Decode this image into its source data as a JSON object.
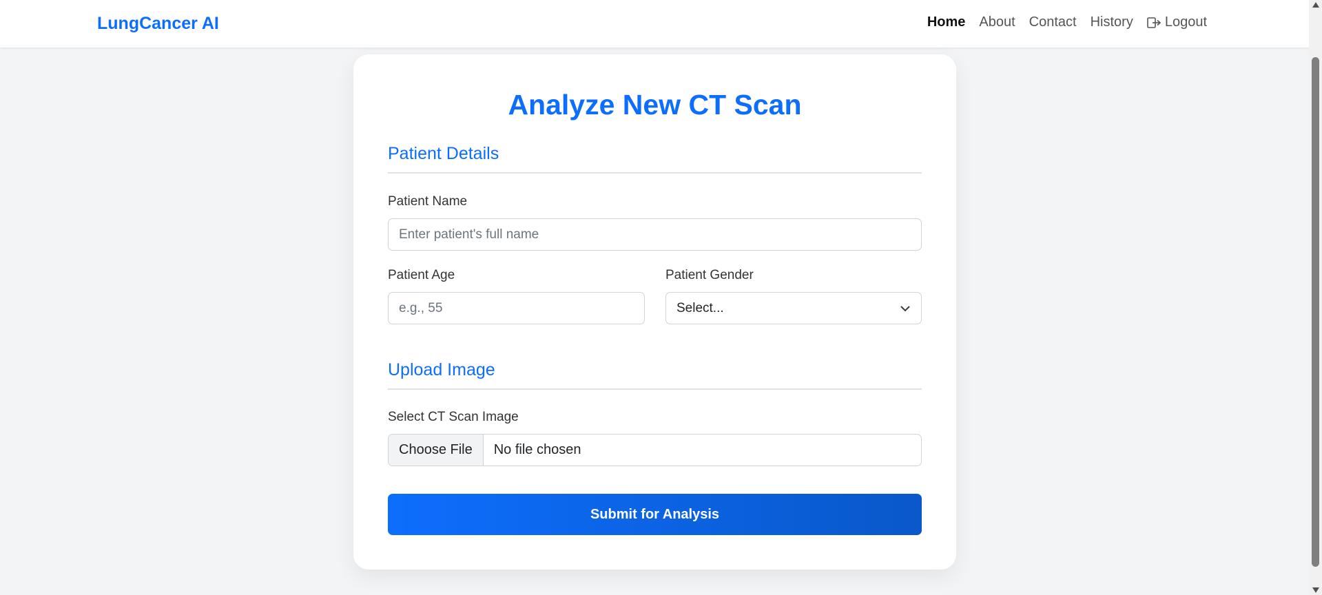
{
  "navbar": {
    "brand": "LungCancer AI",
    "links": {
      "home": "Home",
      "about": "About",
      "contact": "Contact",
      "history": "History",
      "logout": "Logout"
    }
  },
  "form": {
    "title": "Analyze New CT Scan",
    "patient_section": "Patient Details",
    "name_label": "Patient Name",
    "name_placeholder": "Enter patient's full name",
    "age_label": "Patient Age",
    "age_placeholder": "e.g., 55",
    "gender_label": "Patient Gender",
    "gender_selected": "Select...",
    "upload_section": "Upload Image",
    "file_label": "Select CT Scan Image",
    "file_button": "Choose File",
    "file_status": "No file chosen",
    "submit_label": "Submit for Analysis"
  },
  "colors": {
    "accent": "#0d6efd",
    "background": "#f3f4f6"
  }
}
